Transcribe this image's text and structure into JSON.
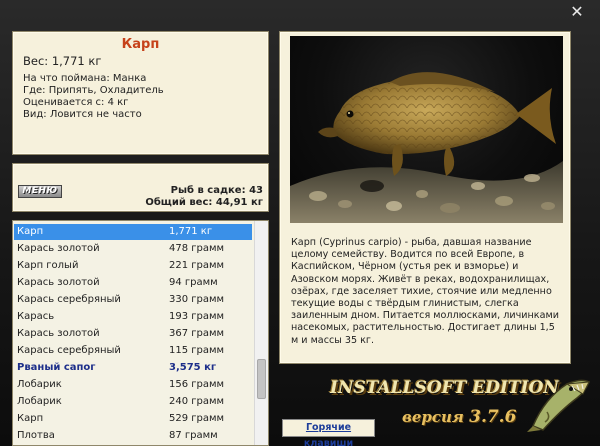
{
  "window": {
    "close_glyph": "✕"
  },
  "info": {
    "title": "Карп",
    "weight": "Вес: 1,771 кг",
    "lines": [
      "На что поймана: Манка",
      "Где: Припять, Охладитель",
      "Оценивается с: 4 кг",
      "Вид: Ловится не часто"
    ]
  },
  "stats": {
    "menu_label": "МЕНЮ",
    "fish_in_net": "Рыб в садке: 43",
    "total_weight": "Общий вес: 44,91 кг"
  },
  "catch_list": [
    {
      "name": "Карп",
      "weight": "1,771 кг",
      "selected": true
    },
    {
      "name": "Карась золотой",
      "weight": "478 грамм"
    },
    {
      "name": "Карп голый",
      "weight": "221 грамм"
    },
    {
      "name": "Карась золотой",
      "weight": "94 грамм"
    },
    {
      "name": "Карась серебряный",
      "weight": "330 грамм"
    },
    {
      "name": "Карась",
      "weight": "193 грамм"
    },
    {
      "name": "Карась золотой",
      "weight": "367 грамм"
    },
    {
      "name": "Карась серебряный",
      "weight": "115 грамм"
    },
    {
      "name": "Рваный сапог",
      "weight": "3,575 кг",
      "trophy": true
    },
    {
      "name": "Лобарик",
      "weight": "156 грамм"
    },
    {
      "name": "Лобарик",
      "weight": "240 грамм"
    },
    {
      "name": "Карп",
      "weight": "529 грамм"
    },
    {
      "name": "Плотва",
      "weight": "87 грамм"
    }
  ],
  "description": "Карп (Cyprinus carpio) - рыба, давшая название целому семейству. Водится по всей Европе, в Каспийском, Чёрном (устья рек и взморье) и Азовском морях. Живёт в реках, водохранилищах, озёрах, где заселяет тихие, стоячие или медленно текущие воды с твёрдым глинистым, слегка заиленным дном. Питается моллюсками, личинками насекомых, растительностью. Достигает длины 1,5 м и массы 35 кг.",
  "hotkeys_label": "Горячие клавиши",
  "brand": {
    "name": "INSTALLSOFT EDITION",
    "version_word": "версия",
    "version_number": "3.7.6"
  },
  "colors": {
    "panel_bg": "#f6f1dc",
    "selection": "#3a90e8",
    "title_red": "#c6421a",
    "trophy_blue": "#1d2f8a"
  },
  "icons": {
    "close": "close-icon",
    "logo": "pike-logo-icon"
  }
}
